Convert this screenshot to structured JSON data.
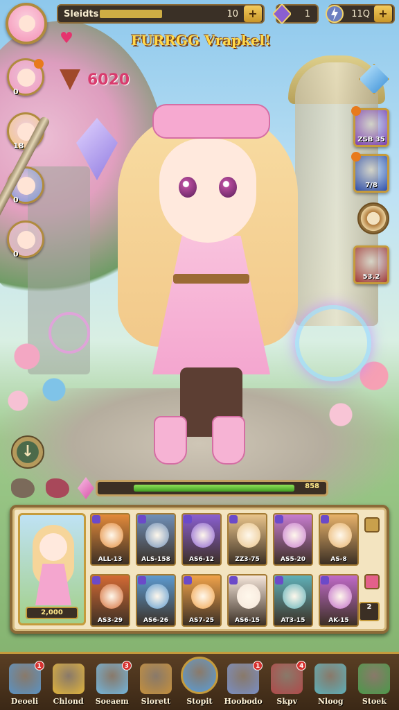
{
  "top": {
    "title": "FURRGG Vrapkel!",
    "resource_label": "Sleidts",
    "resource_value": "10",
    "gem_value": "1",
    "coin_value": "11Q",
    "add_label": "+",
    "power": "6020"
  },
  "party": [
    {
      "level": "0",
      "color": "#f29ac0"
    },
    {
      "level": "18",
      "color": "#f3c985"
    },
    {
      "level": "0",
      "color": "#7f96d8"
    },
    {
      "level": "0",
      "color": "#e9b4c6"
    }
  ],
  "skills": [
    {
      "label": "ZSB 35",
      "color": "#7b3fb0"
    },
    {
      "label": "7/8",
      "color": "#2f4ea8"
    },
    {
      "label": "53.2",
      "color": "#a03a38"
    }
  ],
  "round_button_label": "↓",
  "progress": {
    "value_text": "858",
    "fraction": 0.86
  },
  "inventory": {
    "featured_label": "2,000",
    "items": [
      {
        "label": "ALL-13",
        "color": "#e38a3a"
      },
      {
        "label": "ALS-158",
        "color": "#6f8fb8"
      },
      {
        "label": "AS6-12",
        "color": "#8a5fd0"
      },
      {
        "label": "ZZ3-75",
        "color": "#e9c48a"
      },
      {
        "label": "AS5-20",
        "color": "#c77ccf"
      },
      {
        "label": "AS-8",
        "color": "#e7b26a"
      },
      {
        "label": "AS3-29",
        "color": "#d36a34"
      },
      {
        "label": "AS6-26",
        "color": "#5c9ad0"
      },
      {
        "label": "AS7-25",
        "color": "#f0a24a"
      },
      {
        "label": "AS6-15",
        "color": "#f5e6da"
      },
      {
        "label": "AT3-15",
        "color": "#5fb0b8"
      },
      {
        "label": "AK-15",
        "color": "#c06ac8"
      }
    ],
    "side_count": "2"
  },
  "nav": [
    {
      "label": "Deoeli",
      "badge": "1",
      "color": "#5b93c4"
    },
    {
      "label": "Chlond",
      "badge": "",
      "color": "#e2b53c"
    },
    {
      "label": "Soeaem",
      "badge": "3",
      "color": "#74b6dc"
    },
    {
      "label": "Slorett",
      "badge": "",
      "color": "#c7913c"
    },
    {
      "label": "Stopit",
      "badge": "",
      "color": "#5aa0dc"
    },
    {
      "label": "Hoobodo",
      "badge": "1",
      "color": "#7b8fc4"
    },
    {
      "label": "Skpv",
      "badge": "4",
      "color": "#b24a4a"
    },
    {
      "label": "Nloog",
      "badge": "",
      "color": "#5fb0b8"
    },
    {
      "label": "Stoek",
      "badge": "",
      "color": "#4c9a4a"
    }
  ]
}
